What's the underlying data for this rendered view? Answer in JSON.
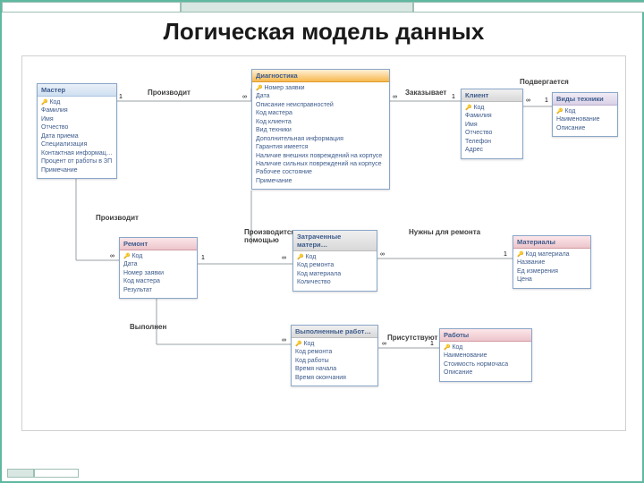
{
  "title": "Логическая модель данных",
  "rel": {
    "produces1": "Производит",
    "orders": "Заказывает",
    "exposes": "Подвергается",
    "produces2": "Производит",
    "withHelp": "Производится с помощью",
    "usedMat": "Затраченные матери…",
    "neededRepair": "Нужны для ремонта",
    "performed": "Выполнен",
    "doneWorks": "Выполненные работ…",
    "present": "Присутствуют"
  },
  "cards": {
    "one": "1",
    "inf": "∞"
  },
  "entities": {
    "master": {
      "title": "Мастер",
      "fields": [
        "Код",
        "Фамилия",
        "Имя",
        "Отчество",
        "Дата приема",
        "Специализация",
        "Контактная информация",
        "Процент от работы в ЗП",
        "Примечание"
      ]
    },
    "diag": {
      "title": "Диагностика",
      "fields": [
        "Номер заявки",
        "Дата",
        "Описание неисправностей",
        "Код мастера",
        "Код клиента",
        "Вид техники",
        "Дополнительная информация",
        "Гарантия имеется",
        "Наличие внешних повреждений на корпусе",
        "Наличие сильных повреждений на корпусе",
        "Рабочее состояние",
        "Примечание"
      ]
    },
    "client": {
      "title": "Клиент",
      "fields": [
        "Код",
        "Фамилия",
        "Имя",
        "Отчество",
        "Телефон",
        "Адрес"
      ]
    },
    "tech": {
      "title": "Виды техники",
      "fields": [
        "Код",
        "Наименование",
        "Описание"
      ]
    },
    "repair": {
      "title": "Ремонт",
      "fields": [
        "Код",
        "Дата",
        "Номер заявки",
        "Код мастера",
        "Результат"
      ]
    },
    "usedMat": {
      "title": "Затраченные матери…",
      "fields": [
        "Код",
        "Код ремонта",
        "Код материала",
        "Количество"
      ]
    },
    "materials": {
      "title": "Материалы",
      "fields": [
        "Код материала",
        "Название",
        "Ед измерения",
        "Цена"
      ]
    },
    "doneWorks": {
      "title": "Выполненные работ…",
      "fields": [
        "Код",
        "Код ремонта",
        "Код работы",
        "Время начала",
        "Время окончания"
      ]
    },
    "works": {
      "title": "Работы",
      "fields": [
        "Код",
        "Наименование",
        "Стоимость нормочаса",
        "Описание"
      ]
    }
  }
}
